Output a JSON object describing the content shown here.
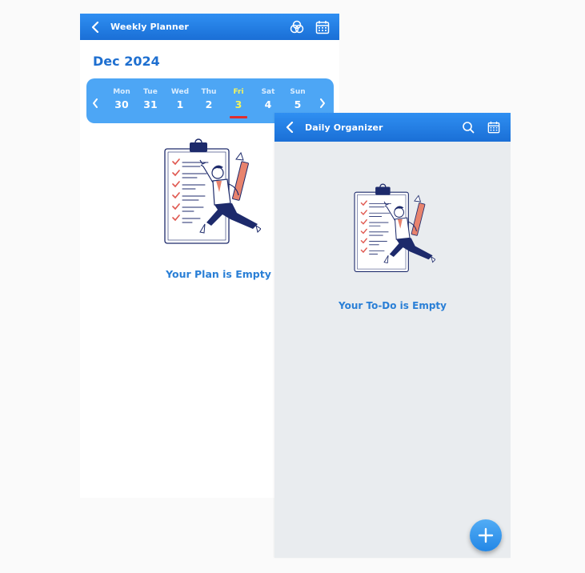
{
  "weekly": {
    "title": "Weekly Planner",
    "month": "Dec 2024",
    "days": [
      {
        "name": "Mon",
        "date": "30"
      },
      {
        "name": "Tue",
        "date": "31"
      },
      {
        "name": "Wed",
        "date": "1"
      },
      {
        "name": "Thu",
        "date": "2"
      },
      {
        "name": "Fri",
        "date": "3"
      },
      {
        "name": "Sat",
        "date": "4"
      },
      {
        "name": "Sun",
        "date": "5"
      }
    ],
    "selected_day": "Fri",
    "empty_text": "Your Plan is Empty"
  },
  "daily": {
    "title": "Daily Organizer",
    "empty_text": "Your To-Do is Empty"
  },
  "colors": {
    "app_bar": "#1f7fe3",
    "week_bar": "#4da6f5",
    "selected_day": "#f4f55e",
    "selected_underline": "#e02e2e",
    "accent_text": "#1e6fd0"
  },
  "icons": {
    "back": "chevron-left-icon",
    "filter": "overlap-circles-icon",
    "calendar": "calendar-icon",
    "search": "search-icon",
    "add": "plus-icon"
  }
}
